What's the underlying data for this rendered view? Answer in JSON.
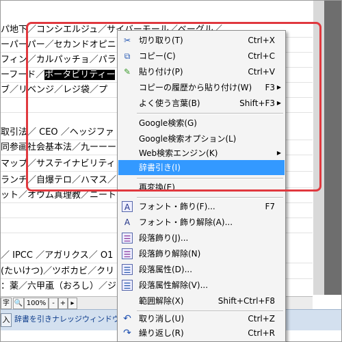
{
  "document": {
    "lines": [
      "パ地下／コンシエルジュ／サイバーモール／ベーグル／",
      "ーパーパー／セカンドオピニオ",
      "フィン／カルパッチョ／パラ",
      "ーフード／",
      "ブ／リベンジ／レジ袋／プ",
      "",
      "",
      "取引法／ CEO ／ヘッジファ",
      "同参画社会基本法／九ーーー",
      "マップ／サステイナビリティ",
      "ランチ／自爆テロ／ハマス／",
      "ット／オウム真理教／ニート",
      "",
      "",
      "",
      "／ IPCC ／アガリクス／ O1",
      "(たいけつ)／ツボカビ／クリ",
      "：薬／六甲颪（おろし）／ジ"
    ],
    "highlight": "ポータビリティー"
  },
  "status1": {
    "char_label": "字",
    "zoom": "100%",
    "minus": "-",
    "plus": "+",
    "next": "▸"
  },
  "status2": {
    "mode": "入",
    "message": "辞書を引きナレッジウィンドウに表示"
  },
  "context_menu": {
    "items": [
      {
        "icon": "scissors-icon",
        "glyph": "✂",
        "label": "切り取り(T)",
        "shortcut": "Ctrl+X"
      },
      {
        "icon": "copy-icon",
        "glyph": "⧉",
        "label": "コピー(C)",
        "shortcut": "Ctrl+C"
      },
      {
        "icon": "paste-icon",
        "glyph": "✎",
        "label": "貼り付け(P)",
        "shortcut": "Ctrl+V"
      },
      {
        "icon": "",
        "glyph": "",
        "label": "コピーの履歴から貼り付け(W)",
        "shortcut": "F3"
      },
      {
        "icon": "",
        "glyph": "",
        "label": "よく使う言葉(B)",
        "shortcut": "Shift+F3"
      },
      {
        "icon": "",
        "glyph": "",
        "label": "Google検索(G)",
        "shortcut": ""
      },
      {
        "icon": "",
        "glyph": "",
        "label": "Google検索オプション(L)",
        "shortcut": ""
      },
      {
        "icon": "",
        "glyph": "",
        "label": "Web検索エンジン(K)",
        "shortcut": ""
      },
      {
        "icon": "",
        "glyph": "",
        "label": "辞書引き(I)",
        "shortcut": ""
      },
      {
        "icon": "",
        "glyph": "",
        "label": "再変換(E)",
        "shortcut": ""
      },
      {
        "icon": "font-style-icon",
        "glyph": "A",
        "label": "フォント・飾り(F)...",
        "shortcut": "F7"
      },
      {
        "icon": "font-style-clear-icon",
        "glyph": "A",
        "label": "フォント・飾り解除(A)...",
        "shortcut": ""
      },
      {
        "icon": "paragraph-style-icon",
        "glyph": "☰",
        "label": "段落飾り(J)...",
        "shortcut": ""
      },
      {
        "icon": "paragraph-style-clear-icon",
        "glyph": "☰",
        "label": "段落飾り解除(N)",
        "shortcut": ""
      },
      {
        "icon": "paragraph-attr-icon",
        "glyph": "☰",
        "label": "段落属性(D)...",
        "shortcut": ""
      },
      {
        "icon": "paragraph-attr-clear-icon",
        "glyph": "☰",
        "label": "段落属性解除(V)...",
        "shortcut": ""
      },
      {
        "icon": "",
        "glyph": "",
        "label": "範囲解除(X)",
        "shortcut": "Shift+Ctrl+F8"
      },
      {
        "icon": "undo-icon",
        "glyph": "↶",
        "label": "取り消し(U)",
        "shortcut": "Ctrl+Z"
      },
      {
        "icon": "redo-icon",
        "glyph": "↷",
        "label": "繰り返し(R)",
        "shortcut": "Ctrl+R"
      }
    ],
    "selected_index": 8,
    "colors": {
      "selected_bg": "#3399ff",
      "annotation_outline": "#e0383e"
    }
  }
}
